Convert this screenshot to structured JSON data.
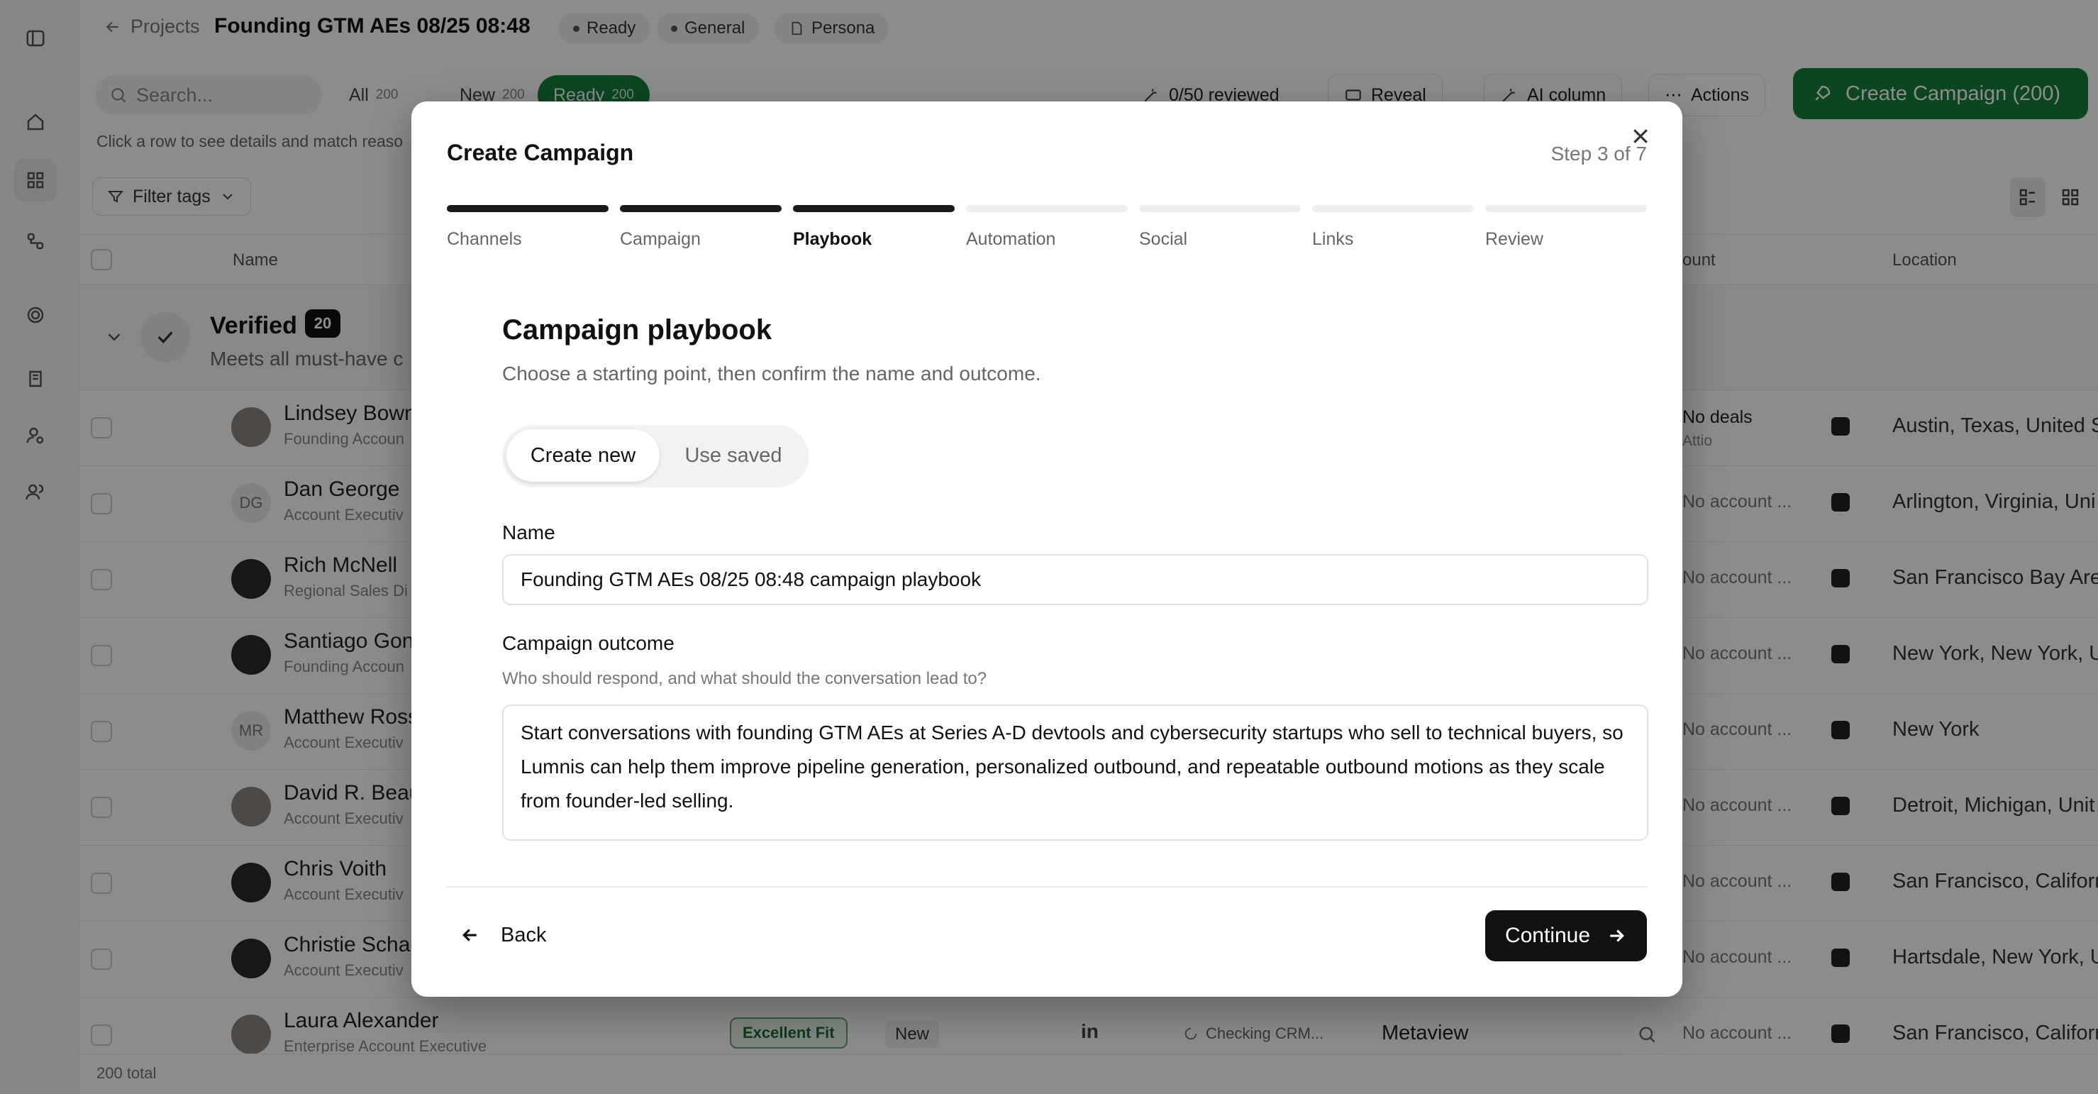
{
  "header": {
    "back_label": "Projects",
    "title": "Founding GTM AEs 08/25 08:48",
    "pills": [
      "Ready",
      "General",
      "Persona"
    ]
  },
  "toolbar": {
    "search_placeholder": "Search...",
    "filters": [
      {
        "label": "All",
        "count": "200"
      },
      {
        "label": "New",
        "count": "200"
      },
      {
        "label": "Ready",
        "count": "200"
      }
    ],
    "reviewed": "0/50 reviewed",
    "reveal": "Reveal",
    "ai_column": "AI column",
    "actions": "Actions",
    "create_campaign": "Create Campaign  (200)"
  },
  "hint": "Click a row to see details and match reaso",
  "filter_tags": "Filter tags",
  "table": {
    "col_name": "Name",
    "col_account": "ount",
    "col_location": "Location",
    "group": {
      "title": "Verified",
      "count": "20",
      "subtitle": "Meets all must-have c"
    },
    "rows": [
      {
        "name": "Lindsey Bown",
        "role": "Founding Accoun",
        "initials": "",
        "crm": "No deals",
        "crm_sub": "Attio",
        "location": "Austin, Texas, United S"
      },
      {
        "name": "Dan George",
        "role": "Account Executiv",
        "initials": "DG",
        "crm": "No account ...",
        "crm_sub": "",
        "location": "Arlington, Virginia, Uni"
      },
      {
        "name": "Rich McNell",
        "role": "Regional Sales Di",
        "initials": "",
        "crm": "No account ...",
        "crm_sub": "",
        "location": "San Francisco Bay Are"
      },
      {
        "name": "Santiago Gonz",
        "role": "Founding Accoun",
        "initials": "",
        "crm": "No account ...",
        "crm_sub": "",
        "location": "New York, New York, U"
      },
      {
        "name": "Matthew Ross",
        "role": "Account Executiv",
        "initials": "MR",
        "crm": "No account ...",
        "crm_sub": "",
        "location": "New York"
      },
      {
        "name": "David R. Beau",
        "role": "Account Executiv",
        "initials": "",
        "crm": "No account ...",
        "crm_sub": "",
        "location": "Detroit, Michigan, Unit"
      },
      {
        "name": "Chris Voith",
        "role": "Account Executiv",
        "initials": "",
        "crm": "No account ...",
        "crm_sub": "",
        "location": "San Francisco, Califorr"
      },
      {
        "name": "Christie Schac",
        "role": "Account Executiv",
        "initials": "",
        "crm": "No account ...",
        "crm_sub": "",
        "location": "Hartsdale, New York, U"
      },
      {
        "name": "Laura Alexander",
        "role": "Enterprise Account Executive",
        "initials": "",
        "crm": "No account ...",
        "crm_sub": "",
        "location": "San Francisco, Califorr"
      }
    ],
    "last_row_extra": {
      "fit": "Excellent Fit",
      "status": "New",
      "linkedin": "in",
      "crm_check": "Checking CRM...",
      "company": "Metaview"
    }
  },
  "footer": "200 total",
  "modal": {
    "title": "Create Campaign",
    "step_text": "Step 3 of 7",
    "steps": [
      "Channels",
      "Campaign",
      "Playbook",
      "Automation",
      "Social",
      "Links",
      "Review"
    ],
    "progress": 0.43,
    "section_title": "Campaign playbook",
    "section_subtitle": "Choose a starting point, then confirm the name and outcome.",
    "toggle": {
      "create": "Create new",
      "saved": "Use saved"
    },
    "name_label": "Name",
    "name_value": "Founding GTM AEs 08/25 08:48 campaign playbook",
    "outcome_label": "Campaign outcome",
    "outcome_help": "Who should respond, and what should the conversation lead to?",
    "outcome_value": "Start conversations with founding GTM AEs at Series A-D devtools and cybersecurity startups who sell to technical buyers, so Lumnis can help them improve pipeline generation, personalized outbound, and repeatable outbound motions as they scale from founder-led selling.",
    "back": "Back",
    "continue": "Continue"
  },
  "colors": {
    "accent_green": "#16803c",
    "dark": "#121212"
  }
}
